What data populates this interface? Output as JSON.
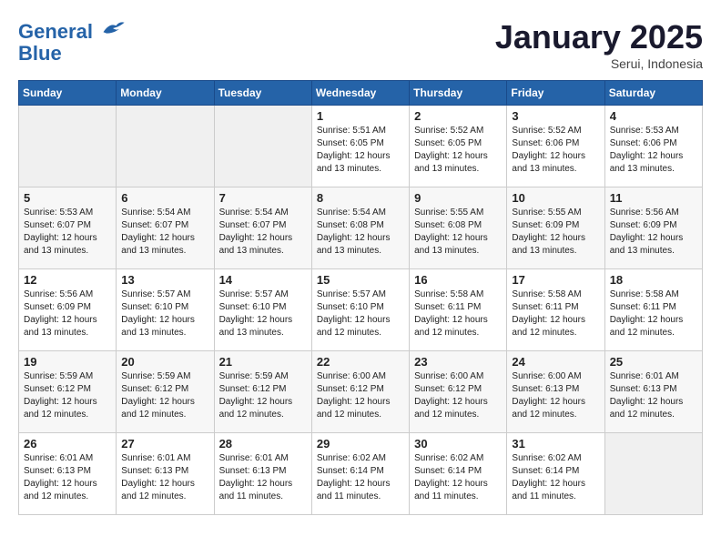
{
  "header": {
    "logo_line1": "General",
    "logo_line2": "Blue",
    "month": "January 2025",
    "location": "Serui, Indonesia"
  },
  "days_of_week": [
    "Sunday",
    "Monday",
    "Tuesday",
    "Wednesday",
    "Thursday",
    "Friday",
    "Saturday"
  ],
  "weeks": [
    [
      {
        "day": "",
        "empty": true
      },
      {
        "day": "",
        "empty": true
      },
      {
        "day": "",
        "empty": true
      },
      {
        "day": "1",
        "sunrise": "5:51 AM",
        "sunset": "6:05 PM",
        "daylight": "Daylight: 12 hours and 13 minutes."
      },
      {
        "day": "2",
        "sunrise": "5:52 AM",
        "sunset": "6:05 PM",
        "daylight": "Daylight: 12 hours and 13 minutes."
      },
      {
        "day": "3",
        "sunrise": "5:52 AM",
        "sunset": "6:06 PM",
        "daylight": "Daylight: 12 hours and 13 minutes."
      },
      {
        "day": "4",
        "sunrise": "5:53 AM",
        "sunset": "6:06 PM",
        "daylight": "Daylight: 12 hours and 13 minutes."
      }
    ],
    [
      {
        "day": "5",
        "sunrise": "5:53 AM",
        "sunset": "6:07 PM",
        "daylight": "Daylight: 12 hours and 13 minutes."
      },
      {
        "day": "6",
        "sunrise": "5:54 AM",
        "sunset": "6:07 PM",
        "daylight": "Daylight: 12 hours and 13 minutes."
      },
      {
        "day": "7",
        "sunrise": "5:54 AM",
        "sunset": "6:07 PM",
        "daylight": "Daylight: 12 hours and 13 minutes."
      },
      {
        "day": "8",
        "sunrise": "5:54 AM",
        "sunset": "6:08 PM",
        "daylight": "Daylight: 12 hours and 13 minutes."
      },
      {
        "day": "9",
        "sunrise": "5:55 AM",
        "sunset": "6:08 PM",
        "daylight": "Daylight: 12 hours and 13 minutes."
      },
      {
        "day": "10",
        "sunrise": "5:55 AM",
        "sunset": "6:09 PM",
        "daylight": "Daylight: 12 hours and 13 minutes."
      },
      {
        "day": "11",
        "sunrise": "5:56 AM",
        "sunset": "6:09 PM",
        "daylight": "Daylight: 12 hours and 13 minutes."
      }
    ],
    [
      {
        "day": "12",
        "sunrise": "5:56 AM",
        "sunset": "6:09 PM",
        "daylight": "Daylight: 12 hours and 13 minutes."
      },
      {
        "day": "13",
        "sunrise": "5:57 AM",
        "sunset": "6:10 PM",
        "daylight": "Daylight: 12 hours and 13 minutes."
      },
      {
        "day": "14",
        "sunrise": "5:57 AM",
        "sunset": "6:10 PM",
        "daylight": "Daylight: 12 hours and 13 minutes."
      },
      {
        "day": "15",
        "sunrise": "5:57 AM",
        "sunset": "6:10 PM",
        "daylight": "Daylight: 12 hours and 12 minutes."
      },
      {
        "day": "16",
        "sunrise": "5:58 AM",
        "sunset": "6:11 PM",
        "daylight": "Daylight: 12 hours and 12 minutes."
      },
      {
        "day": "17",
        "sunrise": "5:58 AM",
        "sunset": "6:11 PM",
        "daylight": "Daylight: 12 hours and 12 minutes."
      },
      {
        "day": "18",
        "sunrise": "5:58 AM",
        "sunset": "6:11 PM",
        "daylight": "Daylight: 12 hours and 12 minutes."
      }
    ],
    [
      {
        "day": "19",
        "sunrise": "5:59 AM",
        "sunset": "6:12 PM",
        "daylight": "Daylight: 12 hours and 12 minutes."
      },
      {
        "day": "20",
        "sunrise": "5:59 AM",
        "sunset": "6:12 PM",
        "daylight": "Daylight: 12 hours and 12 minutes."
      },
      {
        "day": "21",
        "sunrise": "5:59 AM",
        "sunset": "6:12 PM",
        "daylight": "Daylight: 12 hours and 12 minutes."
      },
      {
        "day": "22",
        "sunrise": "6:00 AM",
        "sunset": "6:12 PM",
        "daylight": "Daylight: 12 hours and 12 minutes."
      },
      {
        "day": "23",
        "sunrise": "6:00 AM",
        "sunset": "6:12 PM",
        "daylight": "Daylight: 12 hours and 12 minutes."
      },
      {
        "day": "24",
        "sunrise": "6:00 AM",
        "sunset": "6:13 PM",
        "daylight": "Daylight: 12 hours and 12 minutes."
      },
      {
        "day": "25",
        "sunrise": "6:01 AM",
        "sunset": "6:13 PM",
        "daylight": "Daylight: 12 hours and 12 minutes."
      }
    ],
    [
      {
        "day": "26",
        "sunrise": "6:01 AM",
        "sunset": "6:13 PM",
        "daylight": "Daylight: 12 hours and 12 minutes."
      },
      {
        "day": "27",
        "sunrise": "6:01 AM",
        "sunset": "6:13 PM",
        "daylight": "Daylight: 12 hours and 12 minutes."
      },
      {
        "day": "28",
        "sunrise": "6:01 AM",
        "sunset": "6:13 PM",
        "daylight": "Daylight: 12 hours and 11 minutes."
      },
      {
        "day": "29",
        "sunrise": "6:02 AM",
        "sunset": "6:14 PM",
        "daylight": "Daylight: 12 hours and 11 minutes."
      },
      {
        "day": "30",
        "sunrise": "6:02 AM",
        "sunset": "6:14 PM",
        "daylight": "Daylight: 12 hours and 11 minutes."
      },
      {
        "day": "31",
        "sunrise": "6:02 AM",
        "sunset": "6:14 PM",
        "daylight": "Daylight: 12 hours and 11 minutes."
      },
      {
        "day": "",
        "empty": true
      }
    ]
  ]
}
